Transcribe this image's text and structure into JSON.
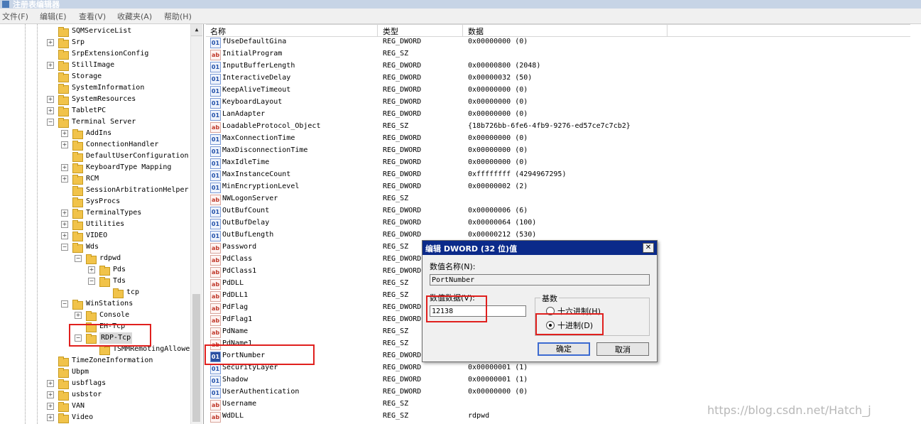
{
  "window": {
    "title": "注册表编辑器"
  },
  "menu": [
    "文件(F)",
    "编辑(E)",
    "查看(V)",
    "收藏夹(A)",
    "帮助(H)"
  ],
  "tree": [
    {
      "label": "SQMServiceList",
      "indent": 0,
      "expander": "none"
    },
    {
      "label": "Srp",
      "indent": 0,
      "expander": "+"
    },
    {
      "label": "SrpExtensionConfig",
      "indent": 0,
      "expander": "none"
    },
    {
      "label": "StillImage",
      "indent": 0,
      "expander": "+"
    },
    {
      "label": "Storage",
      "indent": 0,
      "expander": "none"
    },
    {
      "label": "SystemInformation",
      "indent": 0,
      "expander": "none"
    },
    {
      "label": "SystemResources",
      "indent": 0,
      "expander": "+"
    },
    {
      "label": "TabletPC",
      "indent": 0,
      "expander": "+"
    },
    {
      "label": "Terminal Server",
      "indent": 0,
      "expander": "-"
    },
    {
      "label": "AddIns",
      "indent": 1,
      "expander": "+"
    },
    {
      "label": "ConnectionHandler",
      "indent": 1,
      "expander": "+"
    },
    {
      "label": "DefaultUserConfiguration",
      "indent": 1,
      "expander": "none"
    },
    {
      "label": "KeyboardType Mapping",
      "indent": 1,
      "expander": "+"
    },
    {
      "label": "RCM",
      "indent": 1,
      "expander": "+"
    },
    {
      "label": "SessionArbitrationHelper",
      "indent": 1,
      "expander": "none"
    },
    {
      "label": "SysProcs",
      "indent": 1,
      "expander": "none"
    },
    {
      "label": "TerminalTypes",
      "indent": 1,
      "expander": "+"
    },
    {
      "label": "Utilities",
      "indent": 1,
      "expander": "+"
    },
    {
      "label": "VIDEO",
      "indent": 1,
      "expander": "+"
    },
    {
      "label": "Wds",
      "indent": 1,
      "expander": "-"
    },
    {
      "label": "rdpwd",
      "indent": 2,
      "expander": "-"
    },
    {
      "label": "Pds",
      "indent": 3,
      "expander": "+"
    },
    {
      "label": "Tds",
      "indent": 3,
      "expander": "-"
    },
    {
      "label": "tcp",
      "indent": 4,
      "expander": "none"
    },
    {
      "label": "WinStations",
      "indent": 1,
      "expander": "-"
    },
    {
      "label": "Console",
      "indent": 2,
      "expander": "+"
    },
    {
      "label": "EH-Tcp",
      "indent": 2,
      "expander": "none"
    },
    {
      "label": "RDP-Tcp",
      "indent": 2,
      "expander": "-",
      "selected": true
    },
    {
      "label": "TSMMRemotingAllowe",
      "indent": 3,
      "expander": "none"
    },
    {
      "label": "TimeZoneInformation",
      "indent": 0,
      "expander": "none"
    },
    {
      "label": "Ubpm",
      "indent": 0,
      "expander": "none"
    },
    {
      "label": "usbflags",
      "indent": 0,
      "expander": "+"
    },
    {
      "label": "usbstor",
      "indent": 0,
      "expander": "+"
    },
    {
      "label": "VAN",
      "indent": 0,
      "expander": "+"
    },
    {
      "label": "Video",
      "indent": 0,
      "expander": "+"
    }
  ],
  "list": {
    "headers": {
      "name": "名称",
      "type": "类型",
      "data": "数据"
    },
    "rows": [
      {
        "icon": "dword",
        "name": "fUseDefaultGina",
        "type": "REG_DWORD",
        "data": "0x00000000 (0)"
      },
      {
        "icon": "sz",
        "name": "InitialProgram",
        "type": "REG_SZ",
        "data": ""
      },
      {
        "icon": "dword",
        "name": "InputBufferLength",
        "type": "REG_DWORD",
        "data": "0x00000800 (2048)"
      },
      {
        "icon": "dword",
        "name": "InteractiveDelay",
        "type": "REG_DWORD",
        "data": "0x00000032 (50)"
      },
      {
        "icon": "dword",
        "name": "KeepAliveTimeout",
        "type": "REG_DWORD",
        "data": "0x00000000 (0)"
      },
      {
        "icon": "dword",
        "name": "KeyboardLayout",
        "type": "REG_DWORD",
        "data": "0x00000000 (0)"
      },
      {
        "icon": "dword",
        "name": "LanAdapter",
        "type": "REG_DWORD",
        "data": "0x00000000 (0)"
      },
      {
        "icon": "sz",
        "name": "LoadableProtocol_Object",
        "type": "REG_SZ",
        "data": "{18b726bb-6fe6-4fb9-9276-ed57ce7c7cb2}"
      },
      {
        "icon": "dword",
        "name": "MaxConnectionTime",
        "type": "REG_DWORD",
        "data": "0x00000000 (0)"
      },
      {
        "icon": "dword",
        "name": "MaxDisconnectionTime",
        "type": "REG_DWORD",
        "data": "0x00000000 (0)"
      },
      {
        "icon": "dword",
        "name": "MaxIdleTime",
        "type": "REG_DWORD",
        "data": "0x00000000 (0)"
      },
      {
        "icon": "dword",
        "name": "MaxInstanceCount",
        "type": "REG_DWORD",
        "data": "0xffffffff (4294967295)"
      },
      {
        "icon": "dword",
        "name": "MinEncryptionLevel",
        "type": "REG_DWORD",
        "data": "0x00000002 (2)"
      },
      {
        "icon": "sz",
        "name": "NWLogonServer",
        "type": "REG_SZ",
        "data": ""
      },
      {
        "icon": "dword",
        "name": "OutBufCount",
        "type": "REG_DWORD",
        "data": "0x00000006 (6)"
      },
      {
        "icon": "dword",
        "name": "OutBufDelay",
        "type": "REG_DWORD",
        "data": "0x00000064 (100)"
      },
      {
        "icon": "dword",
        "name": "OutBufLength",
        "type": "REG_DWORD",
        "data": "0x00000212 (530)"
      },
      {
        "icon": "sz",
        "name": "Password",
        "type": "REG_SZ",
        "data": ""
      },
      {
        "icon": "sz",
        "name": "PdClass",
        "type": "REG_DWORD",
        "data": ""
      },
      {
        "icon": "sz",
        "name": "PdClass1",
        "type": "REG_DWORD",
        "data": ""
      },
      {
        "icon": "sz",
        "name": "PdDLL",
        "type": "REG_SZ",
        "data": ""
      },
      {
        "icon": "sz",
        "name": "PdDLL1",
        "type": "REG_SZ",
        "data": ""
      },
      {
        "icon": "sz",
        "name": "PdFlag",
        "type": "REG_DWORD",
        "data": ""
      },
      {
        "icon": "sz",
        "name": "PdFlag1",
        "type": "REG_DWORD",
        "data": ""
      },
      {
        "icon": "sz",
        "name": "PdName",
        "type": "REG_SZ",
        "data": ""
      },
      {
        "icon": "sz",
        "name": "PdName1",
        "type": "REG_SZ",
        "data": ""
      },
      {
        "icon": "dword",
        "name": "PortNumber",
        "type": "REG_DWORD",
        "data": "",
        "selected": true
      },
      {
        "icon": "dword",
        "name": "SecurityLayer",
        "type": "REG_DWORD",
        "data": "0x00000001 (1)"
      },
      {
        "icon": "dword",
        "name": "Shadow",
        "type": "REG_DWORD",
        "data": "0x00000001 (1)"
      },
      {
        "icon": "dword",
        "name": "UserAuthentication",
        "type": "REG_DWORD",
        "data": "0x00000000 (0)"
      },
      {
        "icon": "sz",
        "name": "Username",
        "type": "REG_SZ",
        "data": ""
      },
      {
        "icon": "sz",
        "name": "WdDLL",
        "type": "REG_SZ",
        "data": "rdpwd"
      }
    ]
  },
  "dialog": {
    "title": "编辑 DWORD (32 位)值",
    "close": "✕",
    "value_name_label": "数值名称(N):",
    "value_name": "PortNumber",
    "value_data_label": "数值数据(V):",
    "value_data": "12138",
    "base_label": "基数",
    "hex_label": "十六进制(H)",
    "dec_label": "十进制(D)",
    "base_selected": "dec",
    "ok_label": "确定",
    "cancel_label": "取消"
  },
  "watermark": "https://blog.csdn.net/Hatch_j",
  "colors": {
    "highlight": "#e0201e",
    "dialog_title": "#0b2a8a"
  }
}
